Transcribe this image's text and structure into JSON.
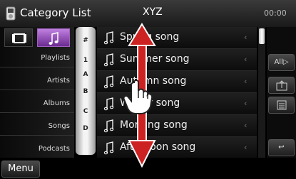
{
  "header": {
    "title": "Category List",
    "source": "XYZ",
    "time": "00:00"
  },
  "left_panel": {
    "tabs": [
      {
        "icon": "video-icon"
      },
      {
        "icon": "music-note-icon",
        "selected": true
      }
    ],
    "categories": [
      "Playlists",
      "Artists",
      "Albums",
      "Songs",
      "Podcasts"
    ]
  },
  "alpha_index": [
    "#",
    "1",
    "A",
    "B",
    "C",
    "D"
  ],
  "songs": [
    "Spring song",
    "Summer song",
    "Autumn song",
    "Winter song",
    "Morning song",
    "Afternoon song"
  ],
  "right_panel": {
    "all_button": "All",
    "buttons": [
      "folder-up-icon",
      "list-mode-icon"
    ]
  },
  "footer": {
    "menu_label": "Menu",
    "return_icon": "return-icon"
  },
  "gesture": {
    "icon": "hand-pointer-icon",
    "direction": "vertical-drag"
  },
  "colors": {
    "accent": "#cc2222",
    "selected_tab": "#a060c0"
  }
}
